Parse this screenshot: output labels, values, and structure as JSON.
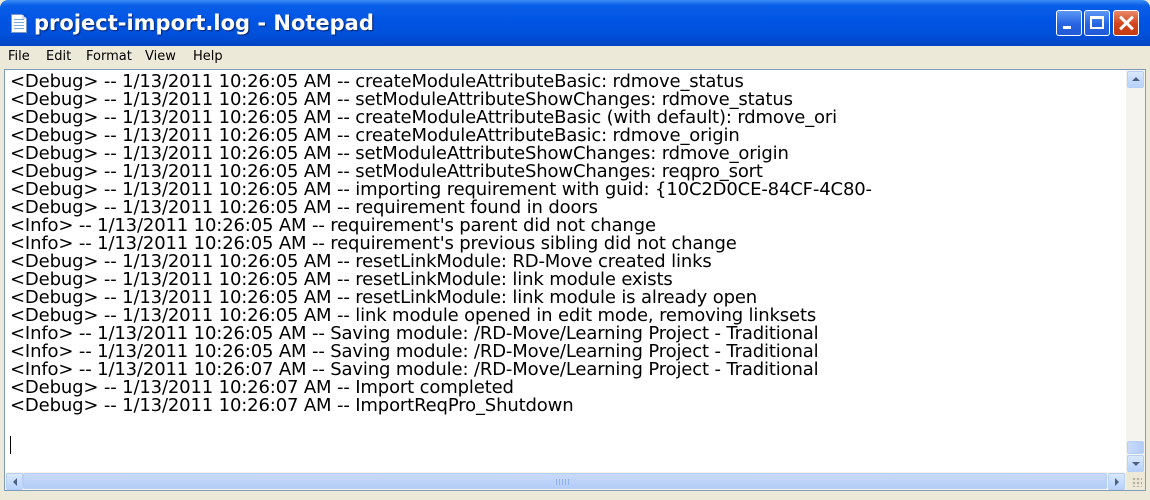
{
  "window": {
    "title": "project-import.log - Notepad"
  },
  "menu": {
    "items": [
      "File",
      "Edit",
      "Format",
      "View",
      "Help"
    ]
  },
  "editor": {
    "lines": [
      "<Debug> -- 1/13/2011 10:26:05 AM -- createModuleAttributeBasic: rdmove_status",
      "<Debug> -- 1/13/2011 10:26:05 AM -- setModuleAttributeShowChanges: rdmove_status",
      "<Debug> -- 1/13/2011 10:26:05 AM -- createModuleAttributeBasic (with default): rdmove_ori",
      "<Debug> -- 1/13/2011 10:26:05 AM -- createModuleAttributeBasic: rdmove_origin",
      "<Debug> -- 1/13/2011 10:26:05 AM -- setModuleAttributeShowChanges: rdmove_origin",
      "<Debug> -- 1/13/2011 10:26:05 AM -- setModuleAttributeShowChanges: reqpro_sort",
      "<Debug> -- 1/13/2011 10:26:05 AM -- importing requirement with guid: {10C2D0CE-84CF-4C80-",
      "<Debug> -- 1/13/2011 10:26:05 AM -- requirement found in doors",
      "<Info> -- 1/13/2011 10:26:05 AM -- requirement's parent did not change",
      "<Info> -- 1/13/2011 10:26:05 AM -- requirement's previous sibling did not change",
      "<Debug> -- 1/13/2011 10:26:05 AM -- resetLinkModule: RD-Move created links",
      "<Debug> -- 1/13/2011 10:26:05 AM -- resetLinkModule: link module exists",
      "<Debug> -- 1/13/2011 10:26:05 AM -- resetLinkModule: link module is already open",
      "<Debug> -- 1/13/2011 10:26:05 AM -- link module opened in edit mode, removing linksets",
      "<Info> -- 1/13/2011 10:26:05 AM -- Saving module: /RD-Move/Learning Project - Traditional",
      "<Info> -- 1/13/2011 10:26:05 AM -- Saving module: /RD-Move/Learning Project - Traditional",
      "<Info> -- 1/13/2011 10:26:07 AM -- Saving module: /RD-Move/Learning Project - Traditional",
      "<Debug> -- 1/13/2011 10:26:07 AM -- Import completed",
      "<Debug> -- 1/13/2011 10:26:07 AM -- ImportReqPro_Shutdown"
    ]
  }
}
